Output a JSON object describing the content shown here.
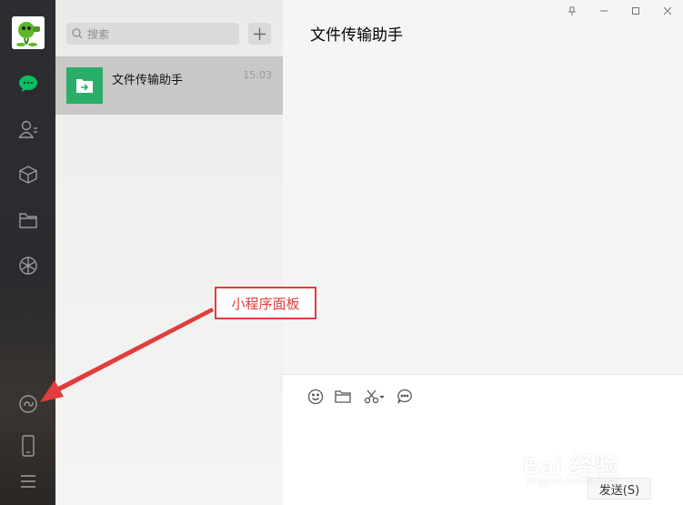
{
  "colors": {
    "rail": "#2b2d31",
    "accent_green": "#2aae67",
    "annotation_red": "#e23c3c",
    "selected_item": "#c9c8c7"
  },
  "search": {
    "placeholder": "搜索"
  },
  "chat_list": [
    {
      "name": "文件传输助手",
      "time": "15:03",
      "icon": "folder-transfer-icon"
    }
  ],
  "chat": {
    "title": "文件传输助手",
    "send_label": "发送(S)"
  },
  "rail_icons": [
    "chat-icon",
    "contacts-icon",
    "favorites-icon",
    "files-icon",
    "moments-icon",
    "mini-program-icon",
    "phone-icon",
    "menu-icon"
  ],
  "toolbar_icons": [
    "emoji-icon",
    "folder-icon",
    "screenshot-icon",
    "chat-history-icon"
  ],
  "annotation": {
    "label": "小程序面板"
  },
  "watermark": {
    "text": "Bai 经验",
    "sub": "jingyan.baidu.com"
  }
}
